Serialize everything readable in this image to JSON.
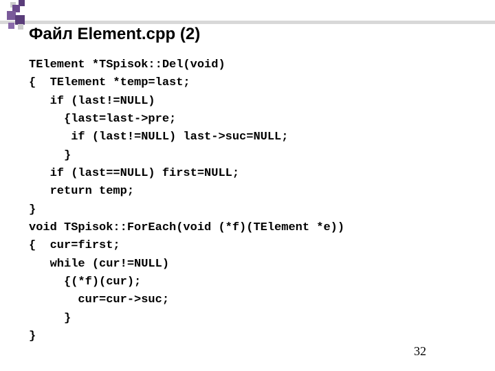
{
  "slide": {
    "title": "Файл Element.cpp (2)",
    "page_number": "32",
    "code_lines": [
      "TElement *TSpisok::Del(void)",
      "{  TElement *temp=last;",
      "   if (last!=NULL)",
      "     {last=last->pre;",
      "      if (last!=NULL) last->suc=NULL;",
      "     }",
      "   if (last==NULL) first=NULL;",
      "   return temp;",
      "}",
      "void TSpisok::ForEach(void (*f)(TElement *e))",
      "{  cur=first;",
      "   while (cur!=NULL)",
      "     {(*f)(cur);",
      "       cur=cur->suc;",
      "     }",
      "}"
    ]
  }
}
